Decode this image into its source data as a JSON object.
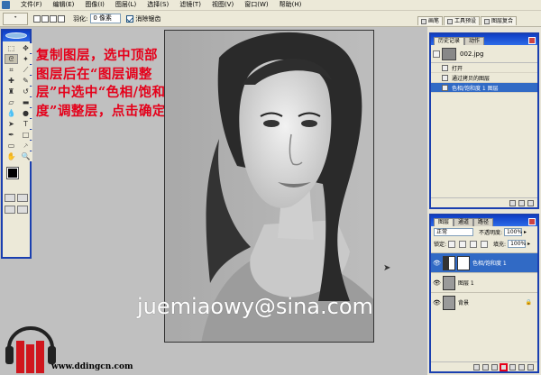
{
  "menu": {
    "items": [
      "文件(F)",
      "编辑(E)",
      "图像(I)",
      "图层(L)",
      "选择(S)",
      "滤镜(T)",
      "视图(V)",
      "窗口(W)",
      "帮助(H)"
    ]
  },
  "options": {
    "feather_label": "羽化:",
    "feather_value": "0 像素",
    "antialias_label": "消除锯齿"
  },
  "palette_well": {
    "tabs": [
      "画笔",
      "工具预设",
      "图层复合"
    ]
  },
  "annotation": "复制图层，选中顶部图层后在“图层调整层”中选中“色相/饱和度”调整层，点击确定",
  "history": {
    "tabs": [
      "历史记录",
      "动作"
    ],
    "snapshot": "002.jpg",
    "rows": [
      "打开",
      "通过拷贝的图层",
      "色相/饱和度 1 图层"
    ],
    "active_index": 2
  },
  "layers": {
    "tabs": [
      "图层",
      "通道",
      "路径"
    ],
    "blend_mode": "正常",
    "opacity_label": "不透明度:",
    "opacity_value": "100%",
    "fill_label": "填充:",
    "fill_value": "100%",
    "lock_label": "锁定:",
    "rows": [
      "色相/饱和度 1",
      "图层 1",
      "背景"
    ],
    "active_index": 0
  },
  "watermark": "juemiaowy@sina.com",
  "site": "www.ddingcn.com",
  "colors": {
    "accent": "#e5001a",
    "title_bar": "#1a3fb0",
    "selection": "#316ac5"
  }
}
